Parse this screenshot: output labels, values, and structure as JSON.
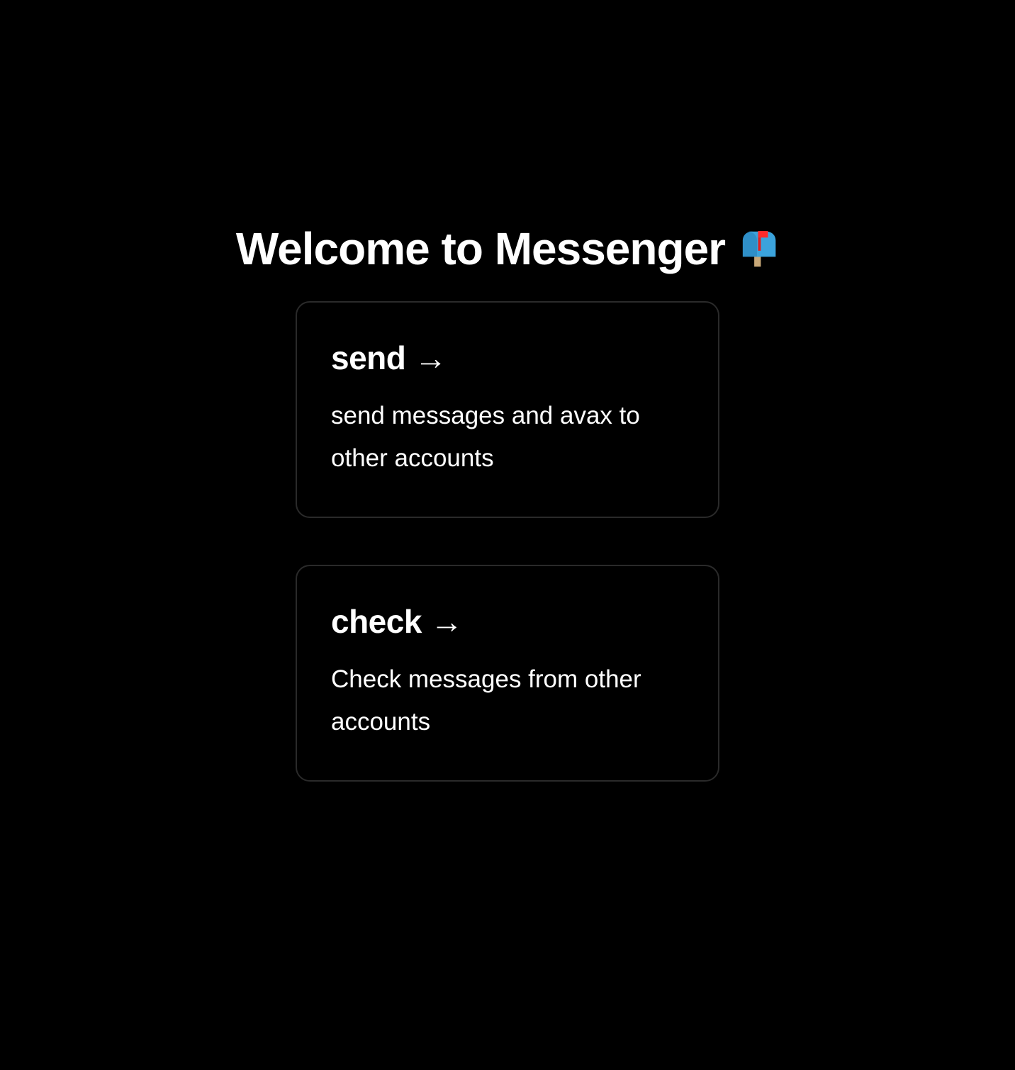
{
  "header": {
    "title": "Welcome to Messenger",
    "icon": "mailbox-with-raised-flag-icon"
  },
  "cards": [
    {
      "title": "send",
      "arrow": "→",
      "description": "send messages and avax to other accounts"
    },
    {
      "title": "check",
      "arrow": "→",
      "description": "Check messages from other accounts"
    }
  ],
  "colors": {
    "background": "#000000",
    "text": "#ffffff",
    "card_border": "#2a2a2a"
  }
}
